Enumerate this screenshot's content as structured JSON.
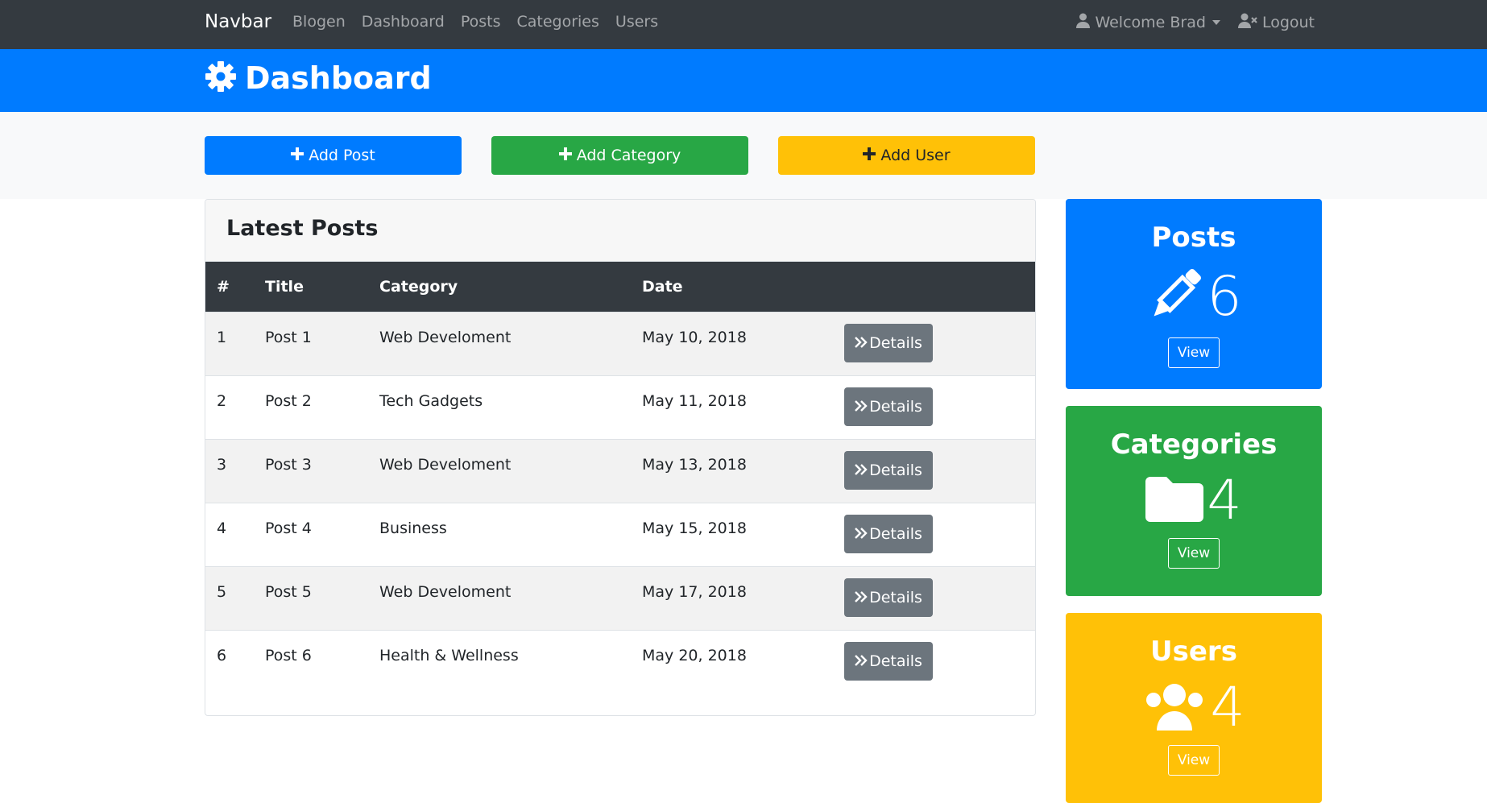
{
  "nav": {
    "brand": "Navbar",
    "links": [
      "Blogen",
      "Dashboard",
      "Posts",
      "Categories",
      "Users"
    ],
    "welcome": "Welcome Brad",
    "logout": "Logout"
  },
  "header": {
    "title": "Dashboard"
  },
  "actions": {
    "add_post": "Add Post",
    "add_category": "Add Category",
    "add_user": "Add User"
  },
  "posts": {
    "title": "Latest Posts",
    "columns": [
      "#",
      "Title",
      "Category",
      "Date"
    ],
    "details_label": "Details",
    "rows": [
      {
        "num": "1",
        "title": "Post 1",
        "category": "Web Develoment",
        "date": "May 10, 2018"
      },
      {
        "num": "2",
        "title": "Post 2",
        "category": "Tech Gadgets",
        "date": "May 11, 2018"
      },
      {
        "num": "3",
        "title": "Post 3",
        "category": "Web Develoment",
        "date": "May 13, 2018"
      },
      {
        "num": "4",
        "title": "Post 4",
        "category": "Business",
        "date": "May 15, 2018"
      },
      {
        "num": "5",
        "title": "Post 5",
        "category": "Web Develoment",
        "date": "May 17, 2018"
      },
      {
        "num": "6",
        "title": "Post 6",
        "category": "Health & Wellness",
        "date": "May 20, 2018"
      }
    ]
  },
  "stats": {
    "posts": {
      "title": "Posts",
      "count": "6",
      "view": "View",
      "icon": "pencil-icon"
    },
    "categories": {
      "title": "Categories",
      "count": "4",
      "view": "View",
      "icon": "folder-icon"
    },
    "users": {
      "title": "Users",
      "count": "4",
      "view": "View",
      "icon": "users-icon"
    }
  },
  "colors": {
    "navbar": "#343a40",
    "primary": "#007bff",
    "success": "#28a745",
    "warning": "#ffc107",
    "secondary": "#6c757d"
  }
}
